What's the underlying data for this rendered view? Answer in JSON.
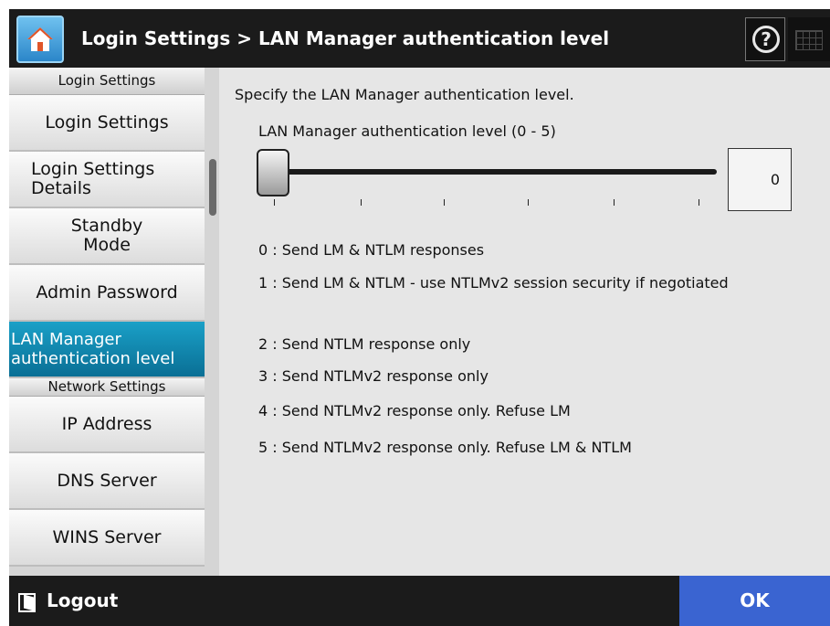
{
  "header": {
    "title": "Login Settings > LAN Manager authentication level",
    "home_icon": "home-icon",
    "help_icon": "help-icon",
    "keyboard_icon": "keyboard-icon",
    "home_color": "#3d9ddd"
  },
  "sidebar": {
    "sections": [
      {
        "header": "Login Settings",
        "items": [
          {
            "label": "Login Settings",
            "active": false
          },
          {
            "label": "Login Settings Details",
            "active": false
          },
          {
            "label": "Standby Mode",
            "active": false
          },
          {
            "label": "Admin Password",
            "active": false
          },
          {
            "label": "LAN Manager authentication level",
            "active": true
          }
        ]
      },
      {
        "header": "Network Settings",
        "items": [
          {
            "label": "IP Address",
            "active": false
          },
          {
            "label": "DNS Server",
            "active": false
          },
          {
            "label": "WINS Server",
            "active": false
          }
        ]
      }
    ],
    "active_color": "#1287b0"
  },
  "main": {
    "lead": "Specify the LAN Manager authentication level.",
    "slider": {
      "label": "LAN Manager authentication level (0 - 5)",
      "min": 0,
      "max": 5,
      "value": "0"
    },
    "levels": [
      "0 : Send LM & NTLM responses",
      "1 : Send LM & NTLM - use NTLMv2 session security if negotiated",
      "2 : Send NTLM response only",
      "3 : Send NTLMv2 response only",
      "4 : Send NTLMv2 response only. Refuse LM",
      "5 : Send NTLMv2 response only. Refuse LM & NTLM"
    ]
  },
  "footer": {
    "logout_label": "Logout",
    "logout_icon": "logout-icon",
    "ok_label": "OK",
    "ok_color": "#3a64d1"
  }
}
